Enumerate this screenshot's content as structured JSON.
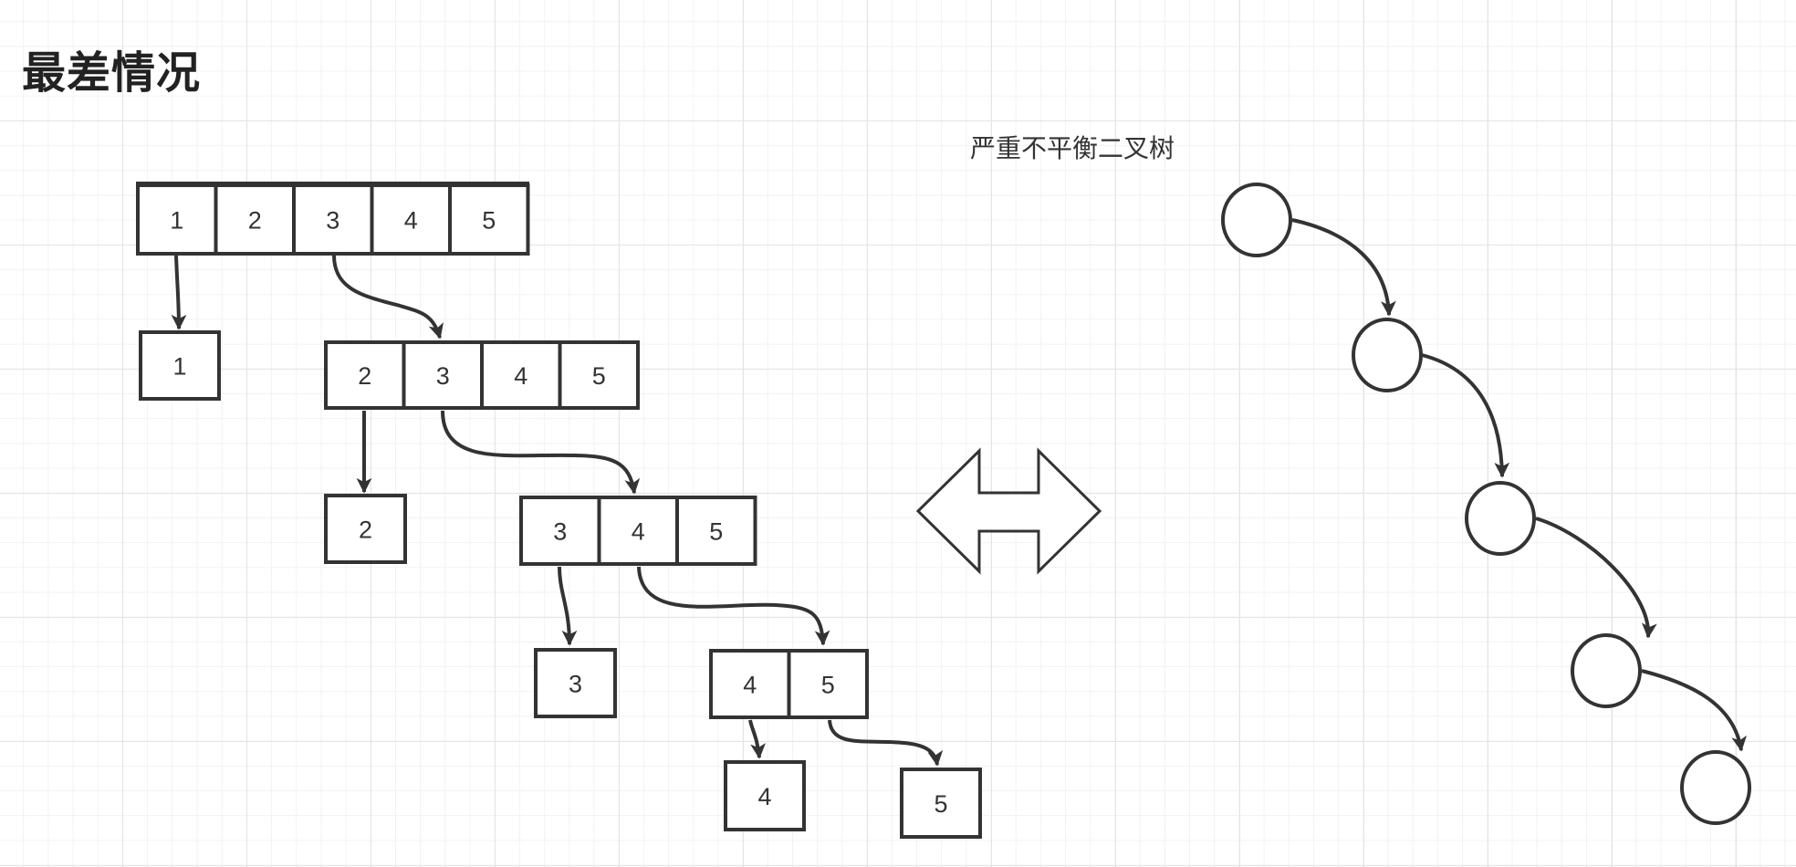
{
  "title": "最差情况",
  "tree_caption": "严重不平衡二叉树",
  "arrays": [
    {
      "values": [
        "1",
        "2",
        "3",
        "4",
        "5"
      ]
    },
    {
      "values": [
        "2",
        "3",
        "4",
        "5"
      ]
    },
    {
      "values": [
        "3",
        "4",
        "5"
      ]
    },
    {
      "values": [
        "4",
        "5"
      ]
    }
  ],
  "singles": [
    "1",
    "2",
    "3",
    "4",
    "5"
  ],
  "tree_node_count": 5
}
